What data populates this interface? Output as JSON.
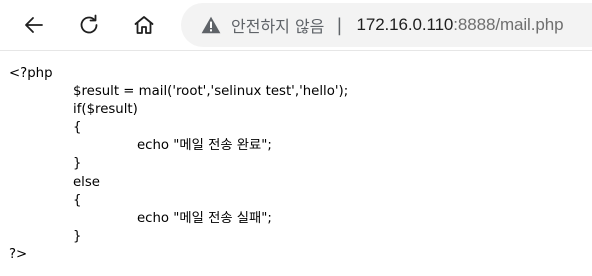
{
  "browser": {
    "security_label": "안전하지 않음",
    "separator": "|",
    "url_host": "172.16.0.110",
    "url_rest": ":8888/mail.php",
    "icons": {
      "back": "arrow-left-icon",
      "reload": "reload-icon",
      "home": "home-icon",
      "warning": "warning-triangle-icon"
    }
  },
  "page": {
    "lines": [
      "<?php",
      "$result = mail('root','selinux test','hello');",
      "if($result)",
      "{",
      "echo \"메일 전송 완료\";",
      "}",
      "else",
      "{",
      "echo \"메일 전송 실패\";",
      "}",
      "?>"
    ]
  }
}
